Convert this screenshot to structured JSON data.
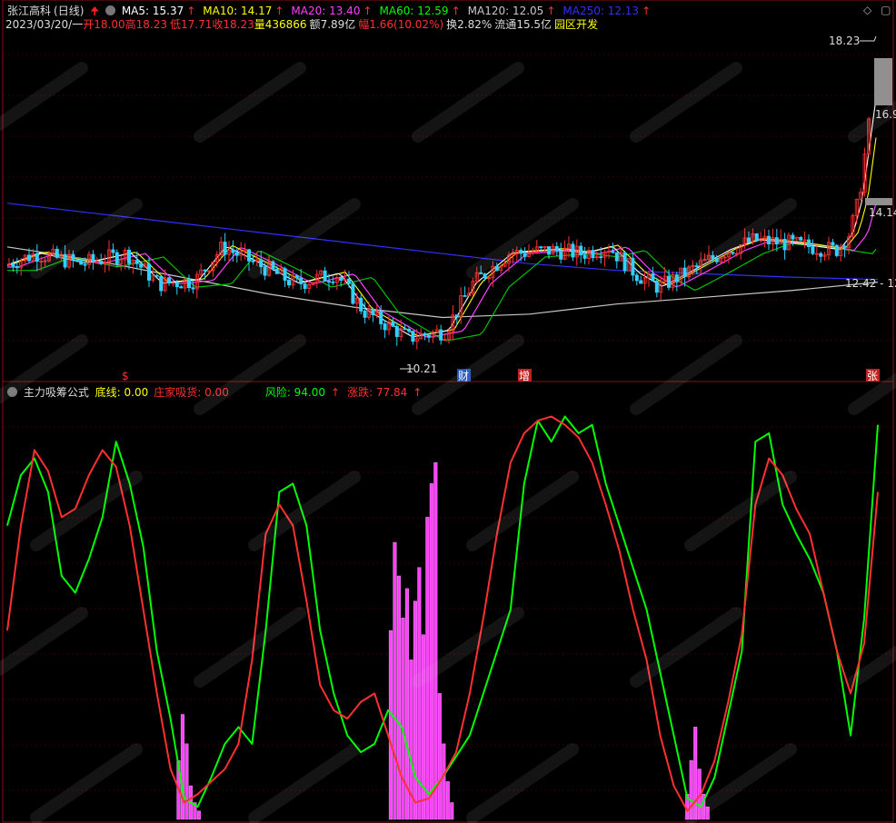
{
  "header": {
    "stock_name": "张江高科",
    "period": "(日线)",
    "ma": [
      {
        "label": "MA5: 15.37",
        "color": "#ffffff"
      },
      {
        "label": "MA10: 14.17",
        "color": "#ffff00"
      },
      {
        "label": "MA20: 13.40",
        "color": "#ff40ff"
      },
      {
        "label": "MA60: 12.59",
        "color": "#00ff00"
      },
      {
        "label": "MA120: 12.05",
        "color": "#c8c8c8"
      },
      {
        "label": "MA250: 12.13",
        "color": "#3030ff"
      }
    ],
    "date": "2023/03/20/一",
    "open_label": "开",
    "open": "18.00",
    "high_label": "高",
    "high": "18.23",
    "low_label": "低",
    "low": "17.71",
    "close_label": "收",
    "close": "18.23",
    "vol_label": "量",
    "vol": "436866",
    "amount_label": "额",
    "amount": "7.89亿",
    "change_label": "幅",
    "change": "1.66(10.02%)",
    "turnover_label": "换",
    "turnover": "2.82%",
    "float_label": "流通",
    "float": "15.5亿",
    "sector": "园区开发"
  },
  "price_chart": {
    "price_labels": {
      "max": "18.23",
      "low": "10.21",
      "right_1": "16.9",
      "right_2": "14.14",
      "right_3": "12.42 - 12"
    },
    "event_markers": [
      {
        "text": "$",
        "color": "#ff3030"
      },
      {
        "text": "财",
        "color": "#ffffff",
        "bg": "#2050c0"
      },
      {
        "text": "增",
        "color": "#ffffff",
        "bg": "#c02020"
      },
      {
        "text": "张",
        "color": "#ffffff",
        "bg": "#c02020"
      }
    ],
    "ylim": [
      9.5,
      19.5
    ],
    "ma_series": {
      "ma250": [
        14.4,
        14.1,
        13.8,
        13.5,
        13.2,
        12.9,
        12.6,
        12.4,
        12.3,
        12.2,
        12.13
      ],
      "ma120": [
        13.1,
        12.7,
        12.2,
        11.7,
        11.3,
        11.0,
        11.1,
        11.4,
        11.6,
        11.8,
        12.05
      ]
    }
  },
  "indicator": {
    "name": "主力吸筹公式",
    "items": [
      {
        "label": "底线: 0.00",
        "color": "#ffff00"
      },
      {
        "label": "庄家吸货: 0.00",
        "color": "#ff3030"
      },
      {
        "label": "风险: 94.00",
        "color": "#00ff00"
      },
      {
        "label": "涨跌: 77.84",
        "color": "#ff3030"
      }
    ]
  },
  "chart_data": [
    {
      "type": "line",
      "title": "主力吸筹公式",
      "ylim": [
        0,
        100
      ],
      "x": [
        0,
        1,
        2,
        3,
        4,
        5,
        6,
        7,
        8,
        9,
        10,
        11,
        12,
        13,
        14,
        15,
        16,
        17,
        18,
        19,
        20,
        21,
        22,
        23,
        24,
        25,
        26,
        27,
        28,
        29,
        30,
        31,
        32,
        33,
        34,
        35,
        36,
        37,
        38,
        39,
        40,
        41,
        42,
        43,
        44,
        45,
        46,
        47,
        48,
        49,
        50,
        51,
        52,
        53,
        54,
        55,
        56,
        57,
        58,
        59,
        60,
        61,
        62,
        63,
        64
      ],
      "series": [
        {
          "name": "风险",
          "color": "#00ff00",
          "values": [
            70,
            82,
            86,
            78,
            58,
            54,
            62,
            72,
            90,
            80,
            65,
            40,
            24,
            5,
            3,
            10,
            18,
            22,
            18,
            45,
            78,
            80,
            70,
            45,
            30,
            20,
            16,
            18,
            26,
            22,
            10,
            6,
            10,
            15,
            20,
            30,
            40,
            50,
            80,
            95,
            90,
            96,
            92,
            94,
            80,
            70,
            60,
            50,
            35,
            20,
            5,
            3,
            10,
            25,
            40,
            90,
            92,
            75,
            68,
            62,
            54,
            40,
            20,
            48,
            94
          ]
        },
        {
          "name": "涨跌",
          "color": "#ff3030",
          "values": [
            45,
            70,
            88,
            83,
            72,
            74,
            82,
            88,
            84,
            70,
            50,
            30,
            12,
            4,
            6,
            9,
            12,
            18,
            38,
            68,
            75,
            70,
            52,
            32,
            26,
            24,
            28,
            30,
            20,
            10,
            4,
            5,
            10,
            16,
            30,
            48,
            68,
            85,
            92,
            95,
            96,
            94,
            91,
            85,
            75,
            64,
            50,
            38,
            20,
            8,
            2,
            6,
            14,
            28,
            44,
            75,
            86,
            82,
            74,
            68,
            54,
            40,
            30,
            42,
            78
          ]
        }
      ]
    },
    {
      "type": "bar",
      "title": "庄家吸货",
      "color": "#ff40ff",
      "bars": [
        {
          "x": 12.6,
          "v": 14
        },
        {
          "x": 12.9,
          "v": 25
        },
        {
          "x": 13.2,
          "v": 18
        },
        {
          "x": 13.5,
          "v": 8
        },
        {
          "x": 13.8,
          "v": 4
        },
        {
          "x": 14.1,
          "v": 2
        },
        {
          "x": 28.2,
          "v": 45
        },
        {
          "x": 28.5,
          "v": 66
        },
        {
          "x": 28.8,
          "v": 58
        },
        {
          "x": 29.1,
          "v": 48
        },
        {
          "x": 29.4,
          "v": 55
        },
        {
          "x": 29.7,
          "v": 38
        },
        {
          "x": 30.0,
          "v": 52
        },
        {
          "x": 30.3,
          "v": 60
        },
        {
          "x": 30.6,
          "v": 44
        },
        {
          "x": 30.9,
          "v": 72
        },
        {
          "x": 31.2,
          "v": 80
        },
        {
          "x": 31.5,
          "v": 85
        },
        {
          "x": 31.8,
          "v": 30
        },
        {
          "x": 32.1,
          "v": 18
        },
        {
          "x": 32.4,
          "v": 9
        },
        {
          "x": 32.7,
          "v": 4
        },
        {
          "x": 50.0,
          "v": 6
        },
        {
          "x": 50.3,
          "v": 14
        },
        {
          "x": 50.6,
          "v": 22
        },
        {
          "x": 50.9,
          "v": 12
        },
        {
          "x": 51.2,
          "v": 6
        },
        {
          "x": 51.5,
          "v": 3
        }
      ]
    }
  ]
}
